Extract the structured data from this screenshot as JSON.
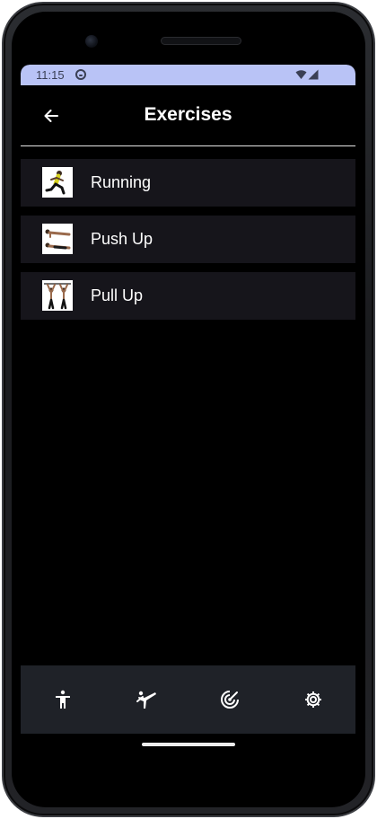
{
  "status_bar": {
    "time": "11:15",
    "icons": [
      "app-notification-icon",
      "wifi-icon",
      "cellular-signal-icon"
    ],
    "color": "#b9c3f6"
  },
  "app_bar": {
    "back_icon": "arrow-left-icon",
    "title": "Exercises"
  },
  "exercises": [
    {
      "label": "Running",
      "thumbnail": "running-person-image"
    },
    {
      "label": "Push Up",
      "thumbnail": "push-up-image"
    },
    {
      "label": "Pull Up",
      "thumbnail": "pull-up-image"
    }
  ],
  "bottom_nav": {
    "items": [
      {
        "icon": "person-standing-icon"
      },
      {
        "icon": "martial-arts-kick-icon"
      },
      {
        "icon": "target-radar-icon"
      },
      {
        "icon": "settings-gear-icon"
      }
    ],
    "background": "#1f2228"
  },
  "theme": {
    "list_item_background": "#16151b",
    "screen_background": "#000000"
  }
}
